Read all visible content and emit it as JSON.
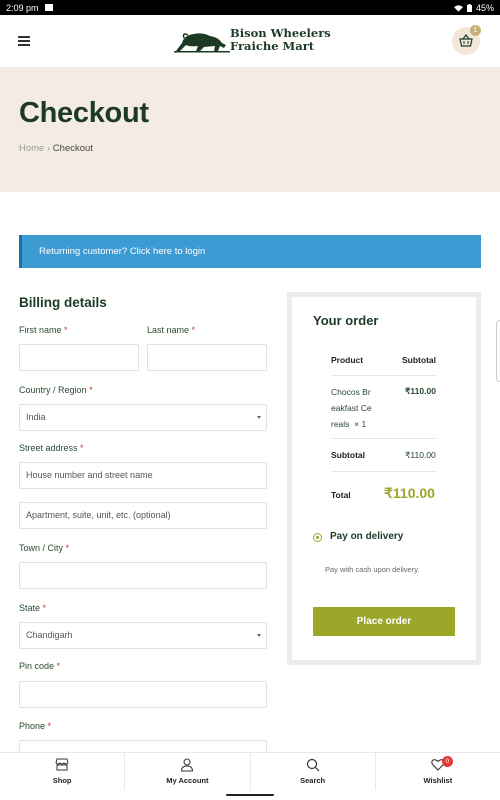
{
  "status_bar": {
    "time": "2:09 pm",
    "battery": "45%"
  },
  "header": {
    "logo_line1": "Bison Wheelers",
    "logo_line2": "Fraiche Mart",
    "cart_count": "1"
  },
  "hero": {
    "title": "Checkout",
    "breadcrumb_home": "Home",
    "breadcrumb_sep": "›",
    "breadcrumb_current": "Checkout"
  },
  "notice": {
    "text": "Returning customer? Click here to login"
  },
  "billing": {
    "title": "Billing details",
    "required_mark": "*",
    "first_name_label": "First name",
    "last_name_label": "Last name",
    "country_label": "Country / Region",
    "country_value": "India",
    "street_label": "Street address",
    "street_placeholder": "House number and street name",
    "street2_placeholder": "Apartment, suite, unit, etc. (optional)",
    "city_label": "Town / City",
    "state_label": "State",
    "state_value": "Chandigarh",
    "pin_label": "Pin code",
    "phone_label": "Phone"
  },
  "order": {
    "title": "Your order",
    "col_product": "Product",
    "col_subtotal": "Subtotal",
    "item_line1": "Chocos Br",
    "item_line2": "eakfast Ce",
    "item_line3": "reals",
    "item_qty": "× 1",
    "item_price": "₹110.00",
    "subtotal_label": "Subtotal",
    "subtotal_value": "₹110.00",
    "total_label": "Total",
    "total_value": "₹110.00",
    "payment_method": "Pay on delivery",
    "payment_desc": "Pay with cash upon delivery.",
    "place_order": "Place order"
  },
  "bottom_nav": {
    "shop": "Shop",
    "account": "My Account",
    "search": "Search",
    "wishlist": "Wishlist",
    "wishlist_count": "0"
  },
  "colors": {
    "accent": "#9aa728",
    "brand_dark": "#1d3b24",
    "notice": "#3d9bd3",
    "hero_bg": "#f4ece2"
  }
}
